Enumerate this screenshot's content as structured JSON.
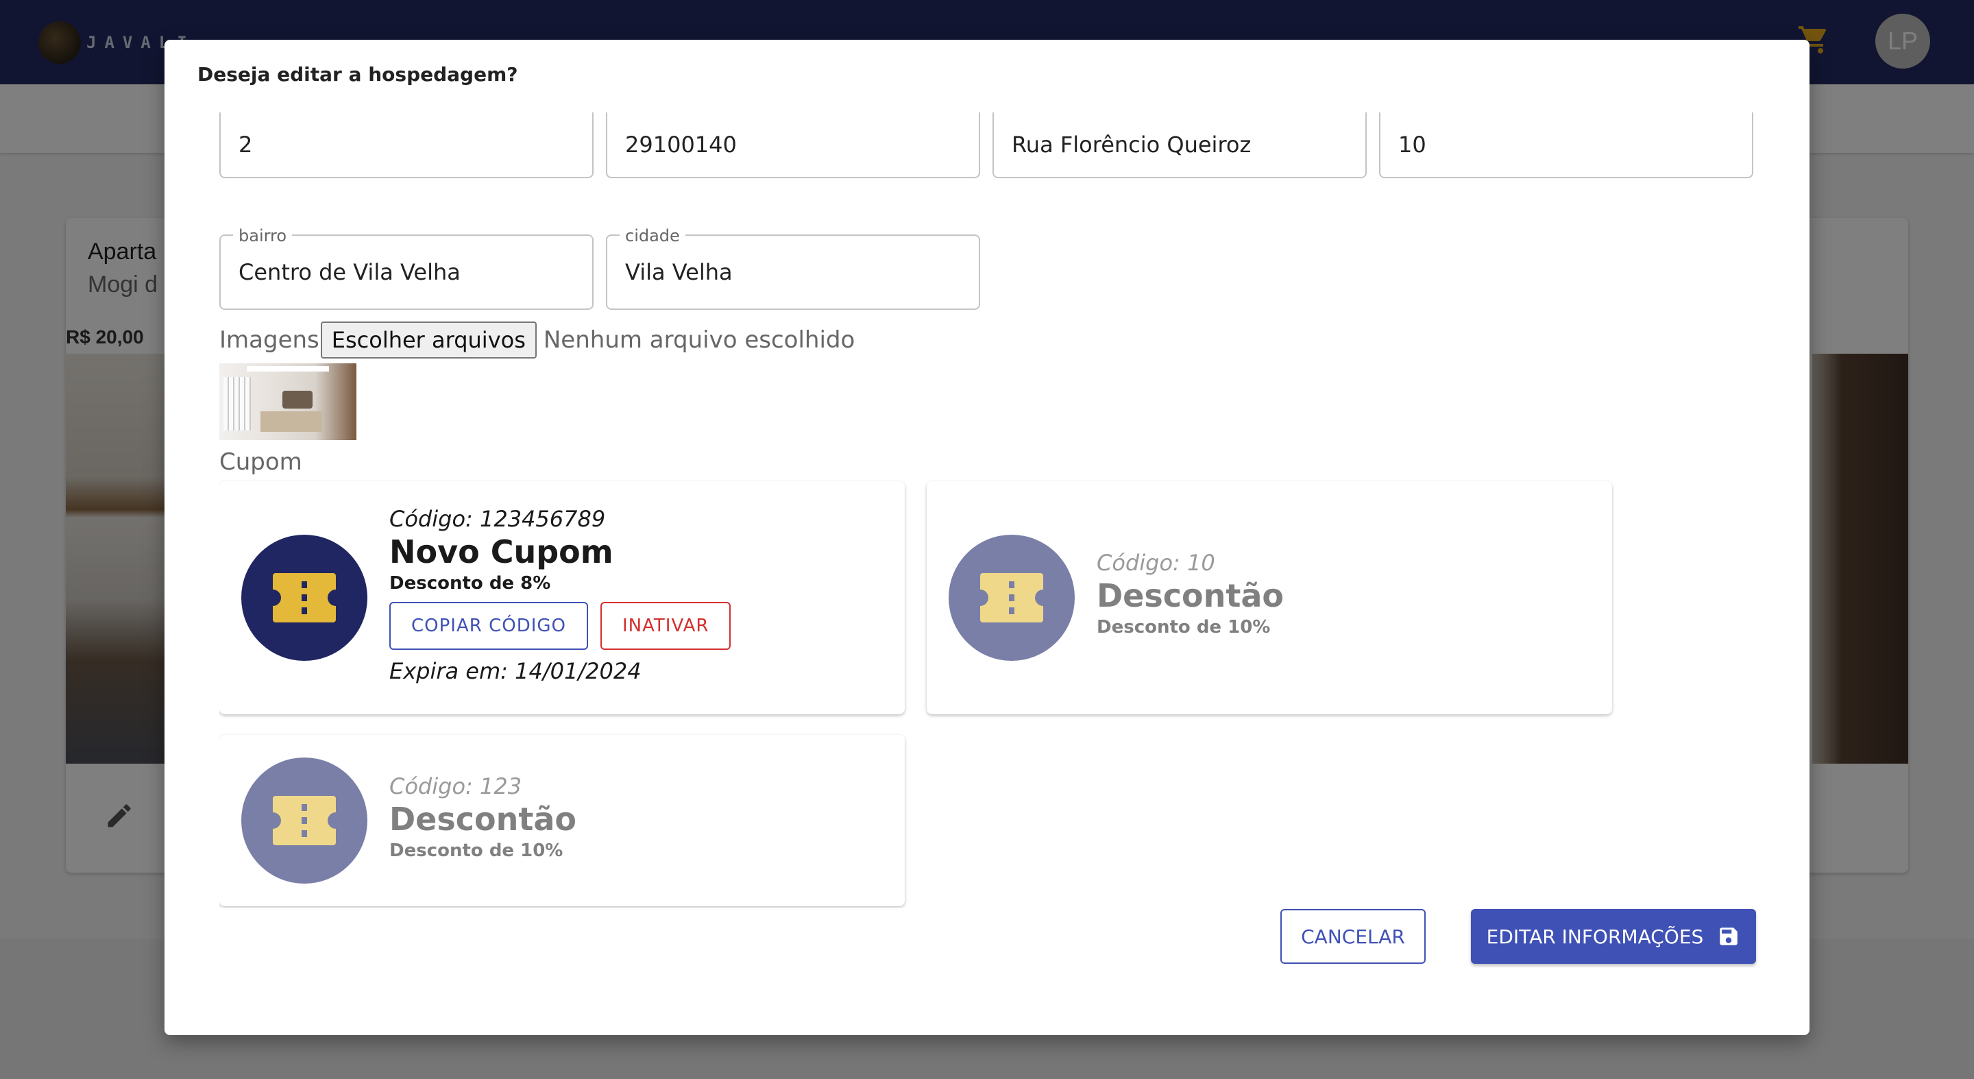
{
  "app": {
    "logo_text": "JAVALI",
    "avatar_initials": "LP"
  },
  "background_card": {
    "title": "Aparta",
    "subtitle": "Mogi d",
    "price": "R$ 20,00"
  },
  "dialog": {
    "title": "Deseja editar a hospedagem?",
    "fields": {
      "numero_quartos": {
        "label": "",
        "value": "2"
      },
      "cep": {
        "label": "",
        "value": "29100140"
      },
      "rua": {
        "label": "",
        "value": "Rua Florêncio Queiroz"
      },
      "numero": {
        "label": "",
        "value": "10"
      },
      "bairro": {
        "label": "bairro",
        "value": "Centro de Vila Velha"
      },
      "cidade": {
        "label": "cidade",
        "value": "Vila Velha"
      }
    },
    "images": {
      "label": "Imagens",
      "button_label": "Escolher arquivos",
      "status": "Nenhum arquivo escolhido"
    },
    "coupons_label": "Cupom",
    "coupons": [
      {
        "code": "Código: 123456789",
        "name": "Novo Cupom",
        "discount": "Desconto de 8%",
        "copy_label": "COPIAR CÓDIGO",
        "deactivate_label": "INATIVAR",
        "expires": "Expira em: 14/01/2024"
      },
      {
        "code": "Código: 10",
        "name": "Descontão",
        "discount": "Desconto de 10%"
      },
      {
        "code": "Código: 123",
        "name": "Descontão",
        "discount": "Desconto de 10%"
      }
    ],
    "cancel_label": "CANCELAR",
    "save_label": "EDITAR INFORMAÇÕES"
  },
  "colors": {
    "appbar": "#232b63",
    "primary": "#3f51b5",
    "danger": "#d32f2f",
    "coupon_active_bg": "#1f2661",
    "coupon_inactive_bg": "#7a7fa8",
    "ticket_active": "#e4b838",
    "ticket_inactive": "#f0d88a"
  },
  "icons": {
    "cart": "cart-icon",
    "edit": "pencil-icon",
    "ticket": "ticket-icon",
    "save": "floppy-disk-icon"
  }
}
